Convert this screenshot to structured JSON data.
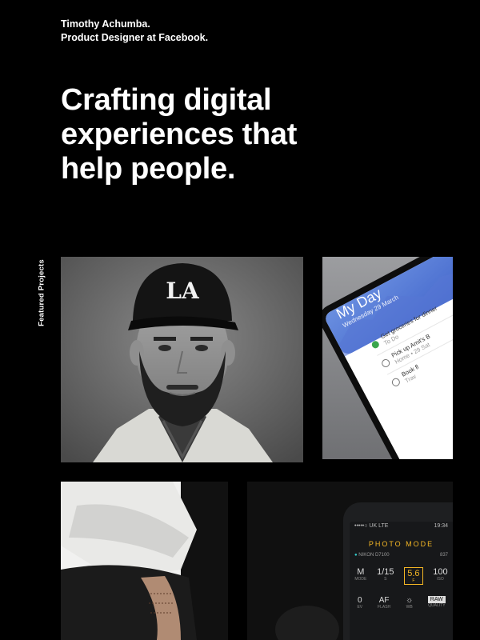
{
  "intro": {
    "name": "Timothy Achumba.",
    "role": "Product Designer at Facebook."
  },
  "hero": {
    "line1": "Crafting digital",
    "line2": "experiences that",
    "line3": "help people."
  },
  "sidebar_label": "Featured Projects",
  "projects": {
    "portrait": {
      "cap_logo": "LA"
    },
    "todo_app": {
      "title": "My Day",
      "date": "Wednesday 29 March",
      "tasks": [
        {
          "title": "Get groceries for dinner",
          "meta": "To Do",
          "done": true
        },
        {
          "title": "Pick up Amit's B",
          "meta": "Home • 29 Sat",
          "done": false
        },
        {
          "title": "Book fl",
          "meta": "Trav",
          "done": false
        }
      ]
    },
    "camera_app": {
      "status_carrier": "•••••○ UK LTE",
      "status_time": "19:34",
      "mode_title": "PHOTO MODE",
      "device": "NIKON D7100",
      "count": "837",
      "settings": [
        {
          "value": "M",
          "label": "MODE"
        },
        {
          "value": "1/15",
          "label": "S"
        },
        {
          "value": "5.6",
          "label": "F"
        },
        {
          "value": "100",
          "label": "ISO"
        }
      ],
      "row2": [
        {
          "value": "0",
          "label": "EV"
        },
        {
          "value": "AF",
          "label": "FLASH"
        },
        {
          "value": "☼",
          "label": "WB"
        },
        {
          "value": "RAW",
          "label": "QUALITY"
        }
      ],
      "accent": "#f5b724"
    }
  },
  "colors": {
    "background": "#000000",
    "text": "#ffffff",
    "todo_blue": "#4a78d6",
    "check_green": "#3aa64c"
  }
}
